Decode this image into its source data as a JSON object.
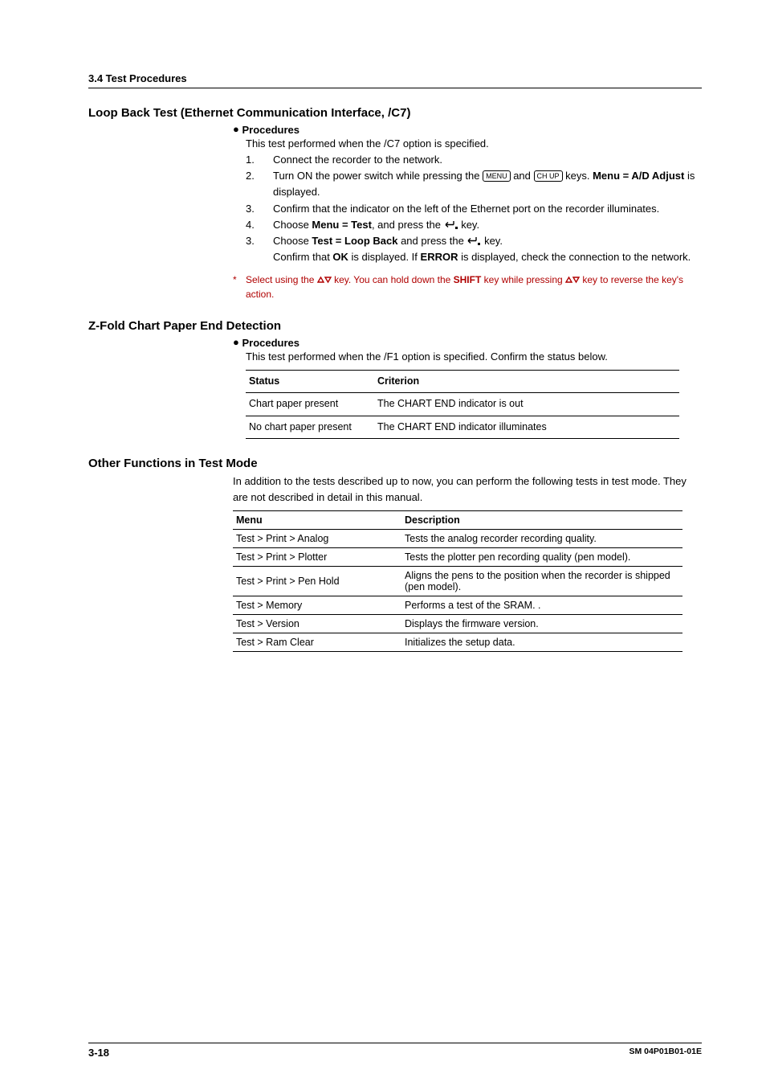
{
  "header": {
    "section": "3.4  Test Procedures"
  },
  "loopback": {
    "title": "Loop Back Test (Ethernet Communication Interface, /C7)",
    "procedures_label": "Procedures",
    "intro": "This test performed when the /C7 option is specified.",
    "steps": [
      {
        "n": "1.",
        "pre": "Connect the recorder to the network."
      },
      {
        "n": "2.",
        "parts": {
          "a": "Turn ON the power switch while pressing the ",
          "key1": "MENU",
          "b": " and ",
          "key2": "CH UP",
          "c": " keys.  ",
          "bold1": "Menu = A/D Adjust",
          "d": " is displayed."
        }
      },
      {
        "n": "3.",
        "pre": "Confirm that the indicator on the left of the Ethernet port on the recorder illuminates."
      },
      {
        "n": "4.",
        "parts4": {
          "a": "Choose ",
          "b": "Menu = Test",
          "c": ", and press the ",
          "d": " key."
        }
      },
      {
        "n": "3.",
        "parts5": {
          "a": "Choose ",
          "b": "Test = Loop Back",
          "c": " and press the ",
          "d": " key.",
          "e": "Confirm that ",
          "ok": "OK",
          "f": " is displayed.  If ",
          "err": "ERROR",
          "g": " is displayed, check the connection to the network."
        }
      }
    ],
    "footnote": {
      "a": "Select using the ",
      "b": " key.   You can hold down the ",
      "shift": "SHIFT",
      "c": " key while pressing ",
      "d": " key to reverse the key's action."
    }
  },
  "zfold": {
    "title": "Z-Fold Chart Paper End Detection",
    "procedures_label": "Procedures",
    "intro": "This test performed when the /F1 option is specified.  Confirm the status below.",
    "table": {
      "h1": "Status",
      "h2": "Criterion",
      "rows": [
        {
          "c1": "Chart paper present",
          "c2": "The CHART END indicator is out"
        },
        {
          "c1": "No chart paper present",
          "c2": "The CHART END indicator illuminates"
        }
      ]
    }
  },
  "other": {
    "title": "Other Functions in Test Mode",
    "intro": "In addition to the tests described up to now, you can perform the following tests in test mode.  They are not described in detail in this manual.",
    "table": {
      "h1": "Menu",
      "h2": "Description",
      "rows": [
        {
          "c1": "Test > Print > Analog",
          "c2": "Tests the analog recorder recording quality."
        },
        {
          "c1": "Test > Print > Plotter",
          "c2": "Tests the plotter pen recording quality (pen model)."
        },
        {
          "c1": "Test > Print > Pen Hold",
          "c2": "Aligns the pens to the position when the recorder is shipped (pen model)."
        },
        {
          "c1": "Test > Memory",
          "c2": "Performs a test of the SRAM. ."
        },
        {
          "c1": "Test > Version",
          "c2": "Displays the firmware version."
        },
        {
          "c1": "Test > Ram Clear",
          "c2": "Initializes the setup data."
        }
      ]
    }
  },
  "footer": {
    "page": "3-18",
    "docid": "SM 04P01B01-01E"
  }
}
